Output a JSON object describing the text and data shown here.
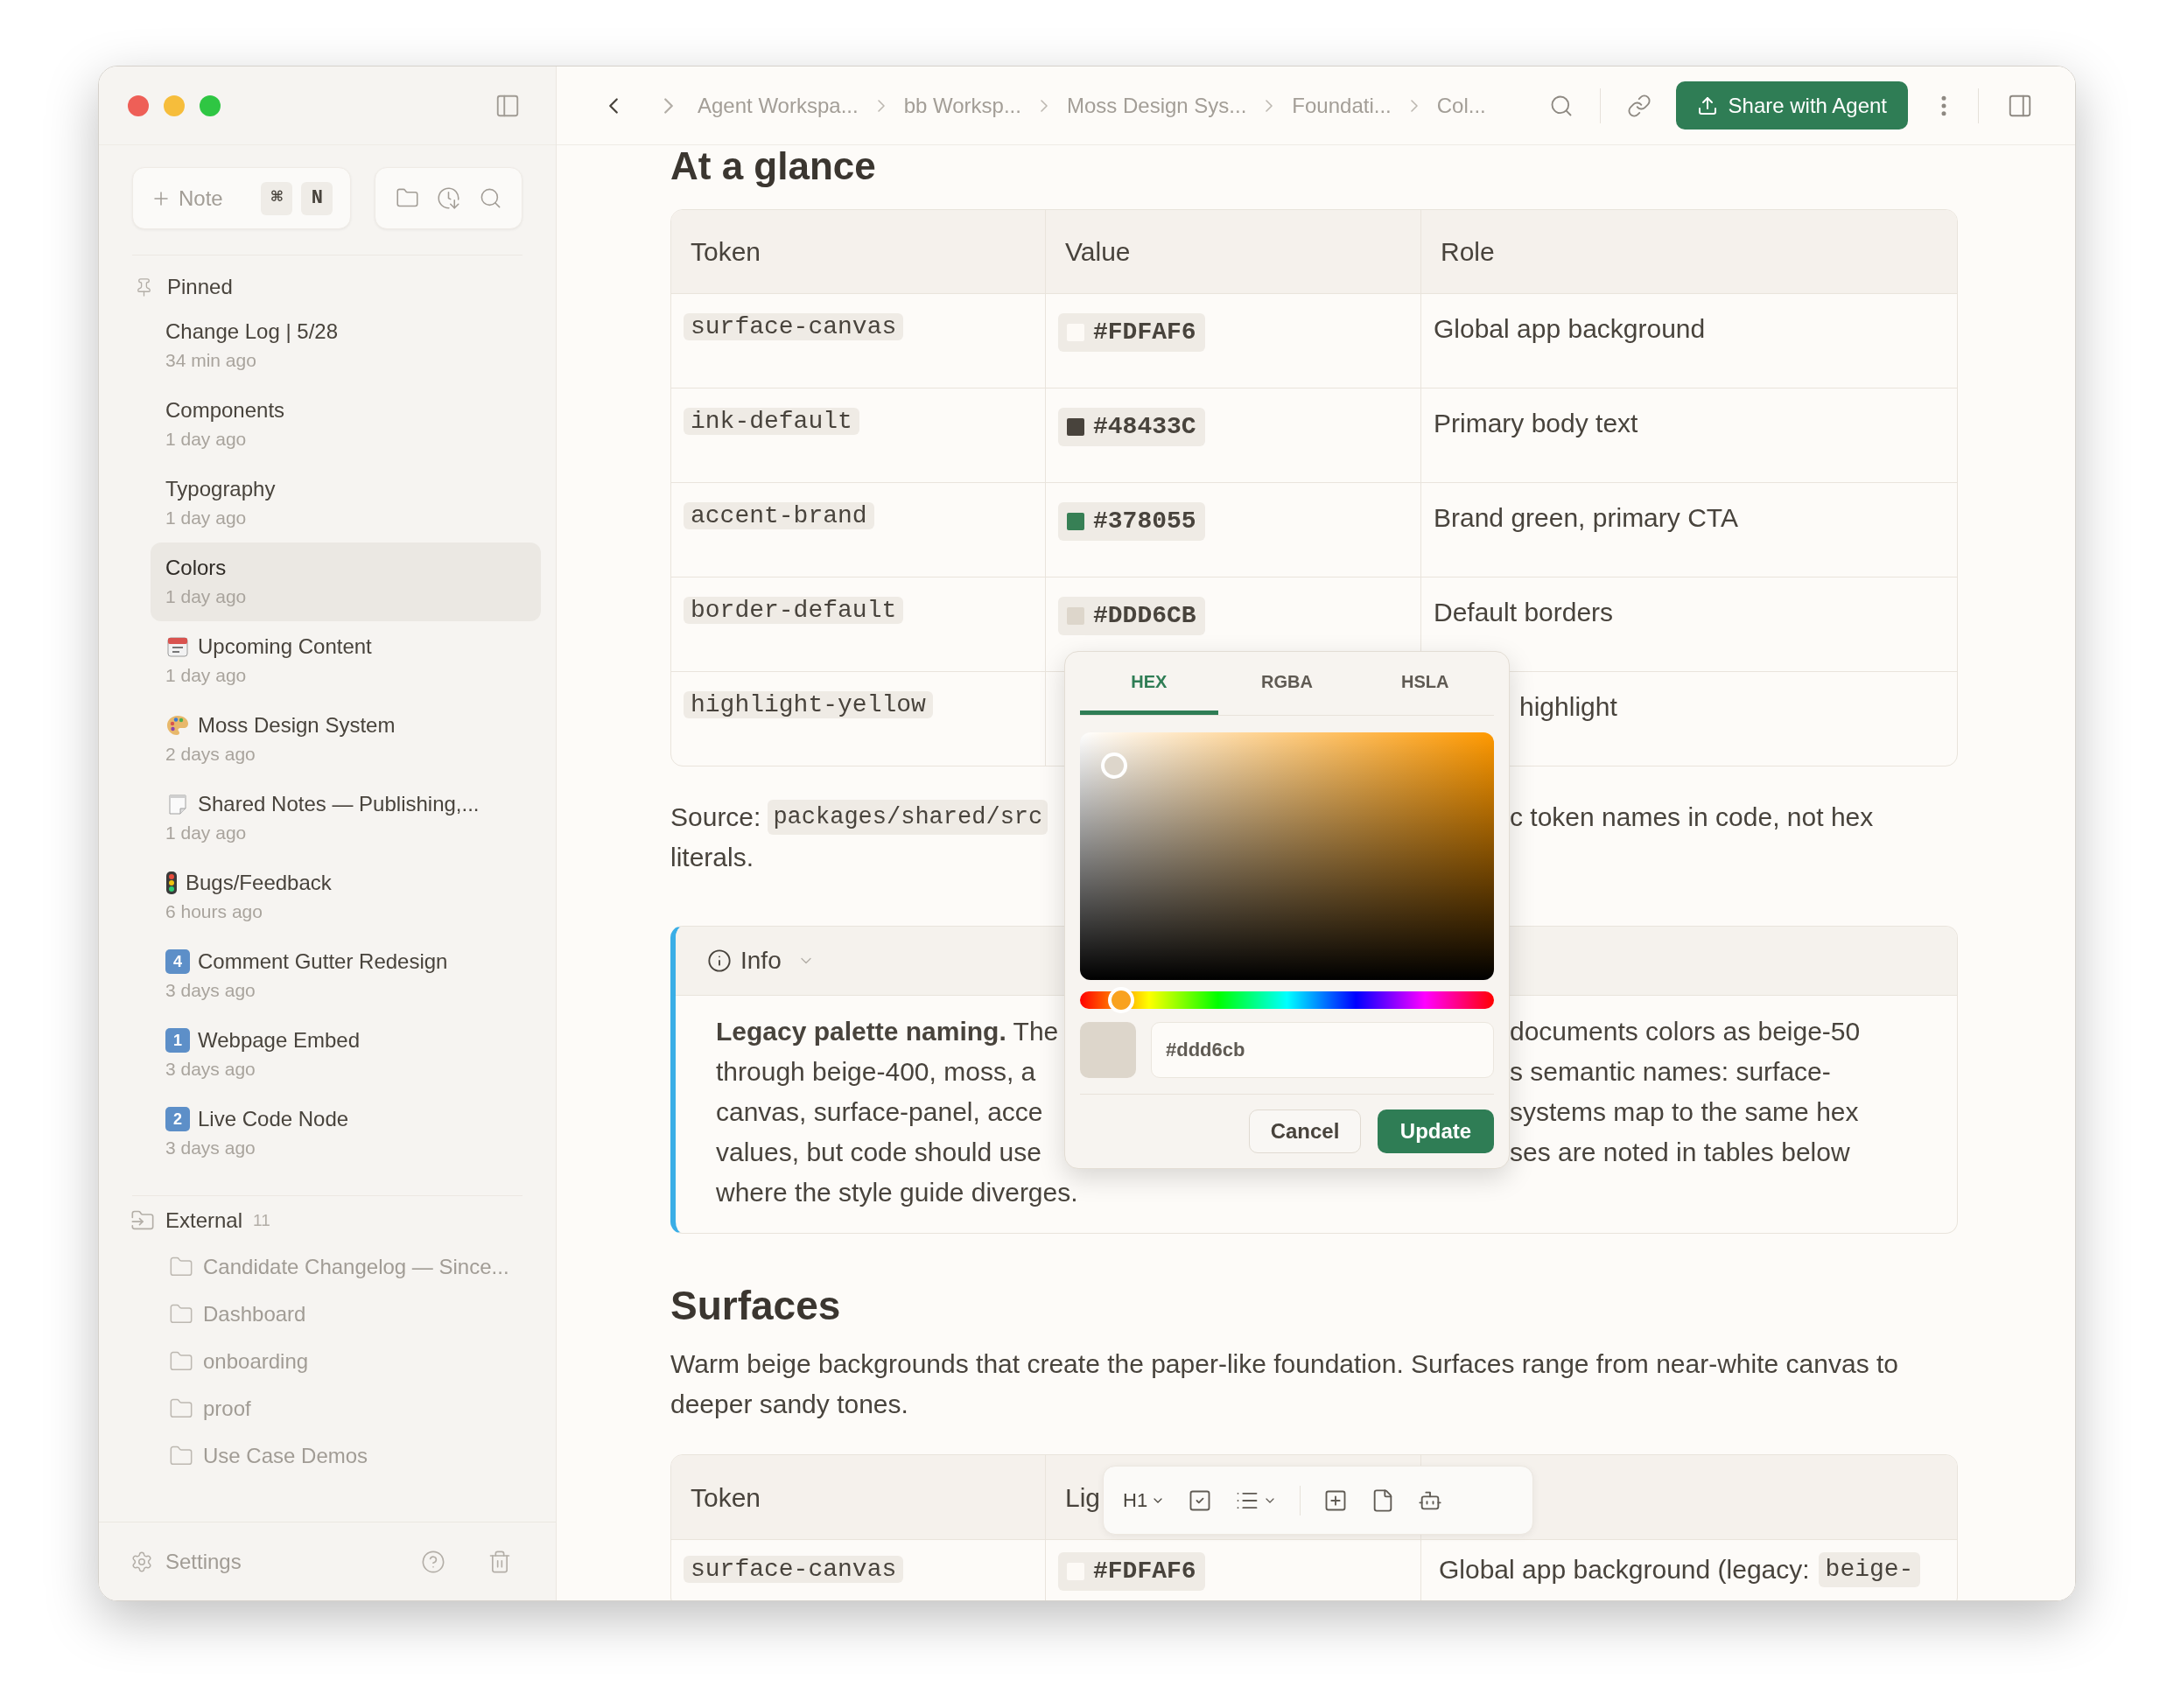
{
  "sidebar": {
    "new_note": {
      "label": "Note",
      "keys": [
        "⌘",
        "N"
      ]
    },
    "pinned": {
      "title": "Pinned",
      "items": [
        {
          "title": "Change Log | 5/28",
          "time": "34 min ago",
          "kind": "plain",
          "selected": false
        },
        {
          "title": "Components",
          "time": "1 day ago",
          "kind": "plain",
          "selected": false
        },
        {
          "title": "Typography",
          "time": "1 day ago",
          "kind": "plain",
          "selected": false
        },
        {
          "title": "Colors",
          "time": "1 day ago",
          "kind": "plain",
          "selected": true
        },
        {
          "title": "Upcoming Content",
          "time": "1 day ago",
          "kind": "calendar",
          "selected": false
        },
        {
          "title": "Moss Design System",
          "time": "2 days ago",
          "kind": "palette",
          "selected": false
        },
        {
          "title": "Shared Notes — Publishing,...",
          "time": "1 day ago",
          "kind": "notepad",
          "selected": false
        },
        {
          "title": "Bugs/Feedback",
          "time": "6 hours ago",
          "kind": "traffic-light",
          "selected": false
        },
        {
          "title": "Comment Gutter Redesign",
          "time": "3 days ago",
          "kind": "keycap",
          "keycap": "4",
          "selected": false
        },
        {
          "title": "Webpage Embed",
          "time": "3 days ago",
          "kind": "keycap",
          "keycap": "1",
          "selected": false
        },
        {
          "title": "Live Code Node",
          "time": "3 days ago",
          "kind": "keycap",
          "keycap": "2",
          "selected": false
        }
      ]
    },
    "external": {
      "title": "External",
      "count": "11",
      "folders": [
        "Candidate Changelog — Since...",
        "Dashboard",
        "onboarding",
        "proof",
        "Use Case Demos"
      ]
    },
    "settings": "Settings"
  },
  "header": {
    "breadcrumbs": [
      "Agent Workspa...",
      "bb Worksp...",
      "Moss Design Sys...",
      "Foundati...",
      "Col..."
    ],
    "share_button": "Share with Agent"
  },
  "glance": {
    "title": "At a glance",
    "columns": [
      "Token",
      "Value",
      "Role"
    ],
    "rows": [
      {
        "token": "surface-canvas",
        "value": "#FDFAF6",
        "color": "#fdfaf6",
        "role": "Global app background"
      },
      {
        "token": "ink-default",
        "value": "#48433C",
        "color": "#48433c",
        "role": "Primary body text"
      },
      {
        "token": "accent-brand",
        "value": "#378055",
        "color": "#378055",
        "role": "Brand green, primary CTA"
      },
      {
        "token": "border-default",
        "value": "#DDD6CB",
        "color": "#ddd6cb",
        "role": "Default borders"
      },
      {
        "token": "highlight-yellow",
        "role": "highlight"
      }
    ]
  },
  "source": {
    "label": "Source:",
    "code": "packages/shared/src",
    "right": "c token names in code, not hex",
    "line2": "literals."
  },
  "callout": {
    "title": "Info",
    "lines": [
      {
        "left": "**Legacy palette naming.** The",
        "right": "documents colors as beige-50"
      },
      {
        "left": "through beige-400, moss, a",
        "right": "s semantic names: surface-"
      },
      {
        "left": "canvas, surface-panel, acce",
        "right": "systems map to the same hex"
      },
      {
        "left": "values, but code should use",
        "right": "ses are noted in tables below"
      },
      {
        "left": "where the style guide diverges."
      }
    ]
  },
  "surfaces": {
    "title": "Surfaces",
    "description": "Warm beige backgrounds that create the paper-like foundation. Surfaces range from near-white canvas to deeper sandy tones.",
    "columns": [
      "Token",
      "Lig"
    ],
    "rows": [
      {
        "token": "surface-canvas",
        "value": "#FDFAF6",
        "color": "#fdfaf6",
        "role": "Global app background (legacy:",
        "role_code": "beige-"
      }
    ]
  },
  "color_picker": {
    "tabs": [
      {
        "label": "HEX",
        "selected": true
      },
      {
        "label": "RGBA",
        "selected": false
      },
      {
        "label": "HSLA",
        "selected": false
      }
    ],
    "hue": {
      "level": 0.1
    },
    "color": "#ddd6cb",
    "value": "#ddd6cb",
    "cancel": "Cancel",
    "update": "Update"
  },
  "toolbar": {
    "heading": "H1"
  }
}
